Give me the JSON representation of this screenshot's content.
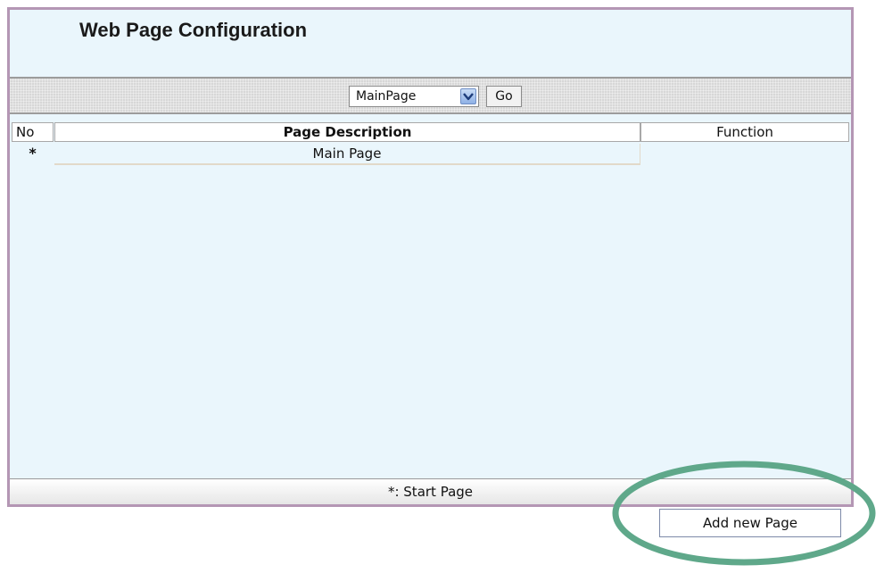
{
  "panel": {
    "title": "Web Page Configuration"
  },
  "toolbar": {
    "page_select": {
      "selected": "MainPage",
      "icon": "chevron-down-icon"
    },
    "go_label": "Go"
  },
  "table": {
    "headers": {
      "no": "No",
      "description": "Page Description",
      "function": "Function"
    },
    "rows": [
      {
        "no": "*",
        "description": "Main Page",
        "function": ""
      }
    ]
  },
  "footer": {
    "legend": "*: Start Page"
  },
  "actions": {
    "add_page_label": "Add new Page"
  },
  "colors": {
    "panel_background": "#eaf6fc",
    "panel_border": "#b496b4",
    "highlight_ring": "#5fa88a"
  }
}
